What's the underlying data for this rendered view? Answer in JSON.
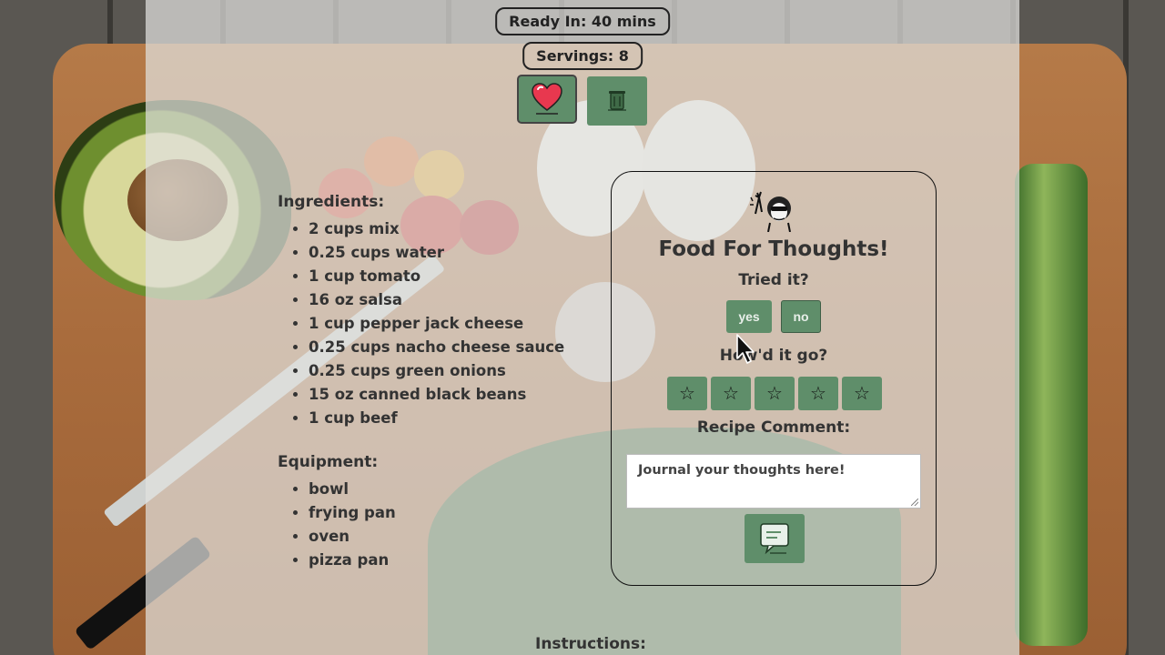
{
  "header": {
    "ready_in": "Ready In: 40 mins",
    "servings": "Servings: 8"
  },
  "actions": {
    "favorite_icon": "heart-icon",
    "delete_icon": "trash-icon"
  },
  "ingredients": {
    "title": "Ingredients:",
    "items": [
      "2 cups mix",
      "0.25 cups water",
      "1 cup tomato",
      "16 oz salsa",
      "1 cup pepper jack cheese",
      "0.25 cups nacho cheese sauce",
      "0.25 cups green onions",
      "15 oz canned black beans",
      "1 cup beef"
    ]
  },
  "equipment": {
    "title": "Equipment:",
    "items": [
      "bowl",
      "frying pan",
      "oven",
      "pizza pan"
    ]
  },
  "thoughts_card": {
    "title": "Food For Thoughts!",
    "tried_label": "Tried it?",
    "yes_label": "yes",
    "no_label": "no",
    "rating_label": "How'd it go?",
    "rating": 0,
    "rating_max": 5,
    "comment_label": "Recipe Comment:",
    "comment_placeholder": "Journal your thoughts here!",
    "submit_icon": "comment-icon"
  },
  "instructions": {
    "title": "Instructions:"
  },
  "colors": {
    "accent": "#5f8e6a",
    "overlay": "#e0e0de"
  }
}
